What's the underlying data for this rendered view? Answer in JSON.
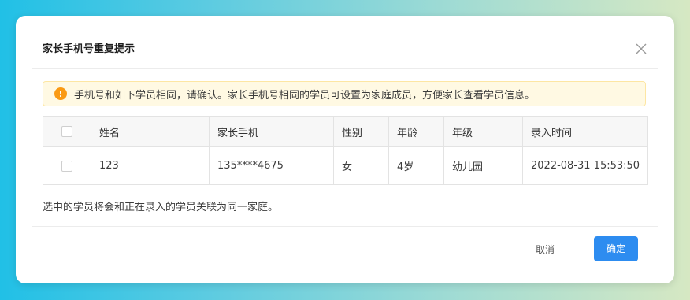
{
  "dialog": {
    "title": "家长手机号重复提示",
    "alert_text": "手机号和如下学员相同，请确认。家长手机号相同的学员可设置为家庭成员，方便家长查看学员信息。",
    "note": "选中的学员将会和正在录入的学员关联为同一家庭。",
    "cancel_label": "取消",
    "confirm_label": "确定",
    "colors": {
      "primary": "#2d8cf0",
      "warning": "#fa9a14",
      "alert_bg": "#fff9e3"
    },
    "icons": {
      "close": "close-icon",
      "warning": "warning-icon"
    }
  },
  "table": {
    "headers": [
      "姓名",
      "家长手机",
      "性别",
      "年龄",
      "年级",
      "录入时间"
    ],
    "rows": [
      {
        "name": "123",
        "parent_phone": "135****4675",
        "gender": "女",
        "age": "4岁",
        "grade": "幼儿园",
        "entry_time": "2022-08-31 15:53:50"
      }
    ]
  }
}
